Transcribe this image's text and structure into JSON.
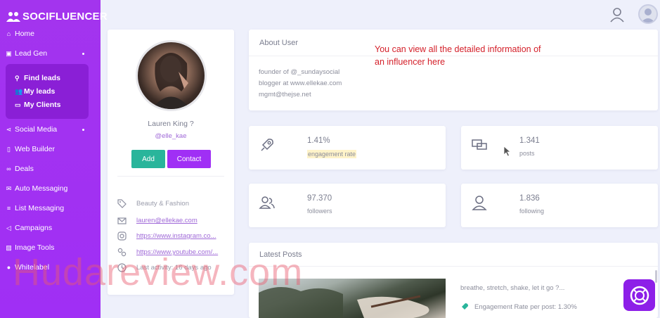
{
  "sidebar": {
    "logo_text": "SOCIFLUENCER",
    "items": {
      "home": "Home",
      "lead_gen": "Lead Gen",
      "social_media": "Social Media",
      "web_builder": "Web Builder",
      "deals": "Deals",
      "auto_messaging": "Auto Messaging",
      "list_messaging": "List Messaging",
      "campaigns": "Campaigns",
      "image_tools": "Image Tools",
      "whitelabel": "Whitelabel"
    },
    "lead_gen_sub": {
      "find_leads": "Find leads",
      "my_leads": "My leads",
      "my_clients": "My Clients"
    },
    "accent_color": "#a334ee"
  },
  "profile": {
    "name": "Lauren King ?",
    "handle": "@elle_kae",
    "add_label": "Add",
    "contact_label": "Contact",
    "category": "Beauty & Fashion",
    "email": "lauren@ellekae.com",
    "instagram": "https://www.instagram.co...",
    "youtube": "https://www.youtube.com/...",
    "last_activity": "Last activity: 16 days ago"
  },
  "about": {
    "title": "About User",
    "bio": [
      "founder of @_sundaysocial",
      "blogger at www.ellekae.com",
      "mgmt@thejse.net"
    ]
  },
  "annotation": {
    "line1": "You can view all the detailed information of",
    "line2": "an influencer here"
  },
  "stats": {
    "engagement": {
      "value": "1.41%",
      "label": "engagement rate",
      "icon": "rocket-icon"
    },
    "posts": {
      "value": "1.341",
      "label": "posts",
      "icon": "chat-icon"
    },
    "followers": {
      "value": "97.370",
      "label": "followers",
      "icon": "users-icon"
    },
    "following": {
      "value": "1.836",
      "label": "following",
      "icon": "user-icon"
    }
  },
  "latest_posts": {
    "title": "Latest Posts",
    "caption": "breathe, stretch, shake, let it go ?...",
    "engagement": "Engagement Rate per post: 1.30%"
  },
  "watermark": "Hudareview.com"
}
